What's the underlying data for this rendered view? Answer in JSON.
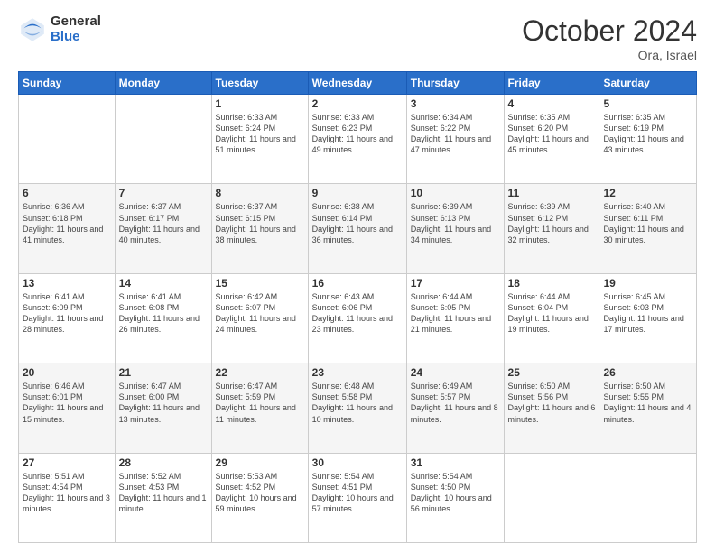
{
  "logo": {
    "general": "General",
    "blue": "Blue"
  },
  "header": {
    "month": "October 2024",
    "location": "Ora, Israel"
  },
  "weekdays": [
    "Sunday",
    "Monday",
    "Tuesday",
    "Wednesday",
    "Thursday",
    "Friday",
    "Saturday"
  ],
  "weeks": [
    [
      {
        "day": "",
        "info": ""
      },
      {
        "day": "",
        "info": ""
      },
      {
        "day": "1",
        "info": "Sunrise: 6:33 AM\nSunset: 6:24 PM\nDaylight: 11 hours and 51 minutes."
      },
      {
        "day": "2",
        "info": "Sunrise: 6:33 AM\nSunset: 6:23 PM\nDaylight: 11 hours and 49 minutes."
      },
      {
        "day": "3",
        "info": "Sunrise: 6:34 AM\nSunset: 6:22 PM\nDaylight: 11 hours and 47 minutes."
      },
      {
        "day": "4",
        "info": "Sunrise: 6:35 AM\nSunset: 6:20 PM\nDaylight: 11 hours and 45 minutes."
      },
      {
        "day": "5",
        "info": "Sunrise: 6:35 AM\nSunset: 6:19 PM\nDaylight: 11 hours and 43 minutes."
      }
    ],
    [
      {
        "day": "6",
        "info": "Sunrise: 6:36 AM\nSunset: 6:18 PM\nDaylight: 11 hours and 41 minutes."
      },
      {
        "day": "7",
        "info": "Sunrise: 6:37 AM\nSunset: 6:17 PM\nDaylight: 11 hours and 40 minutes."
      },
      {
        "day": "8",
        "info": "Sunrise: 6:37 AM\nSunset: 6:15 PM\nDaylight: 11 hours and 38 minutes."
      },
      {
        "day": "9",
        "info": "Sunrise: 6:38 AM\nSunset: 6:14 PM\nDaylight: 11 hours and 36 minutes."
      },
      {
        "day": "10",
        "info": "Sunrise: 6:39 AM\nSunset: 6:13 PM\nDaylight: 11 hours and 34 minutes."
      },
      {
        "day": "11",
        "info": "Sunrise: 6:39 AM\nSunset: 6:12 PM\nDaylight: 11 hours and 32 minutes."
      },
      {
        "day": "12",
        "info": "Sunrise: 6:40 AM\nSunset: 6:11 PM\nDaylight: 11 hours and 30 minutes."
      }
    ],
    [
      {
        "day": "13",
        "info": "Sunrise: 6:41 AM\nSunset: 6:09 PM\nDaylight: 11 hours and 28 minutes."
      },
      {
        "day": "14",
        "info": "Sunrise: 6:41 AM\nSunset: 6:08 PM\nDaylight: 11 hours and 26 minutes."
      },
      {
        "day": "15",
        "info": "Sunrise: 6:42 AM\nSunset: 6:07 PM\nDaylight: 11 hours and 24 minutes."
      },
      {
        "day": "16",
        "info": "Sunrise: 6:43 AM\nSunset: 6:06 PM\nDaylight: 11 hours and 23 minutes."
      },
      {
        "day": "17",
        "info": "Sunrise: 6:44 AM\nSunset: 6:05 PM\nDaylight: 11 hours and 21 minutes."
      },
      {
        "day": "18",
        "info": "Sunrise: 6:44 AM\nSunset: 6:04 PM\nDaylight: 11 hours and 19 minutes."
      },
      {
        "day": "19",
        "info": "Sunrise: 6:45 AM\nSunset: 6:03 PM\nDaylight: 11 hours and 17 minutes."
      }
    ],
    [
      {
        "day": "20",
        "info": "Sunrise: 6:46 AM\nSunset: 6:01 PM\nDaylight: 11 hours and 15 minutes."
      },
      {
        "day": "21",
        "info": "Sunrise: 6:47 AM\nSunset: 6:00 PM\nDaylight: 11 hours and 13 minutes."
      },
      {
        "day": "22",
        "info": "Sunrise: 6:47 AM\nSunset: 5:59 PM\nDaylight: 11 hours and 11 minutes."
      },
      {
        "day": "23",
        "info": "Sunrise: 6:48 AM\nSunset: 5:58 PM\nDaylight: 11 hours and 10 minutes."
      },
      {
        "day": "24",
        "info": "Sunrise: 6:49 AM\nSunset: 5:57 PM\nDaylight: 11 hours and 8 minutes."
      },
      {
        "day": "25",
        "info": "Sunrise: 6:50 AM\nSunset: 5:56 PM\nDaylight: 11 hours and 6 minutes."
      },
      {
        "day": "26",
        "info": "Sunrise: 6:50 AM\nSunset: 5:55 PM\nDaylight: 11 hours and 4 minutes."
      }
    ],
    [
      {
        "day": "27",
        "info": "Sunrise: 5:51 AM\nSunset: 4:54 PM\nDaylight: 11 hours and 3 minutes."
      },
      {
        "day": "28",
        "info": "Sunrise: 5:52 AM\nSunset: 4:53 PM\nDaylight: 11 hours and 1 minute."
      },
      {
        "day": "29",
        "info": "Sunrise: 5:53 AM\nSunset: 4:52 PM\nDaylight: 10 hours and 59 minutes."
      },
      {
        "day": "30",
        "info": "Sunrise: 5:54 AM\nSunset: 4:51 PM\nDaylight: 10 hours and 57 minutes."
      },
      {
        "day": "31",
        "info": "Sunrise: 5:54 AM\nSunset: 4:50 PM\nDaylight: 10 hours and 56 minutes."
      },
      {
        "day": "",
        "info": ""
      },
      {
        "day": "",
        "info": ""
      }
    ]
  ]
}
